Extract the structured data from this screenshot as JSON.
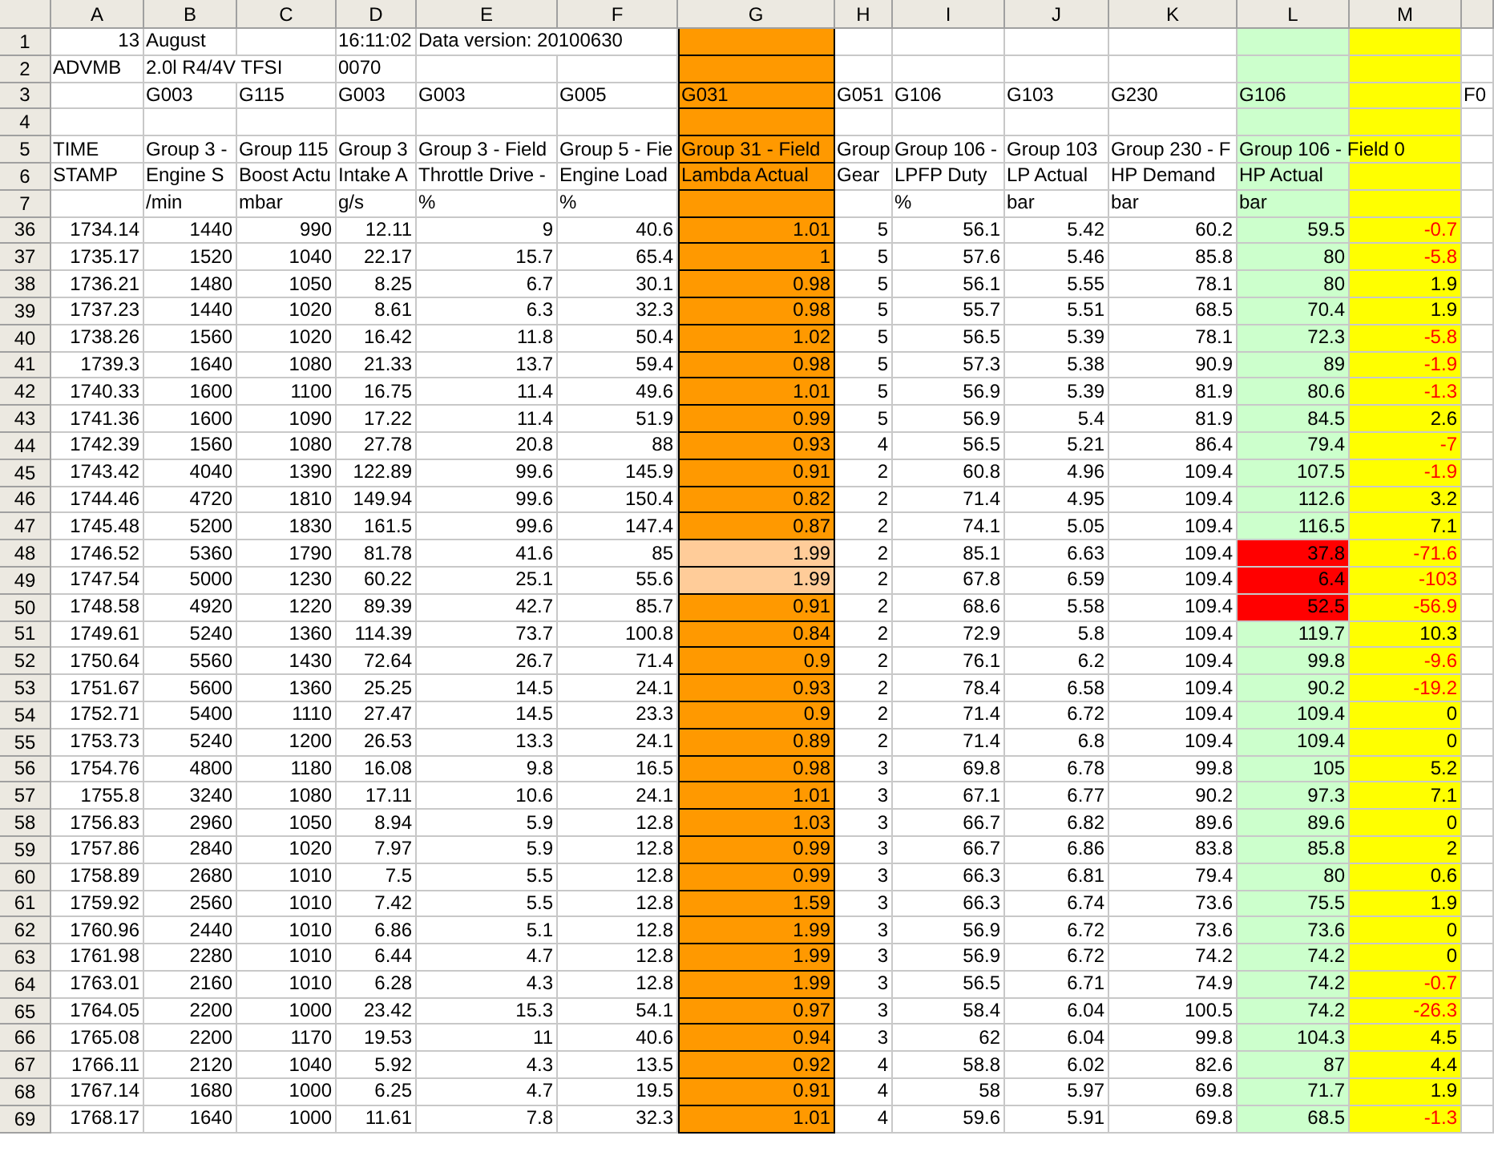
{
  "columns": [
    {
      "label": "A"
    },
    {
      "label": "B"
    },
    {
      "label": "C"
    },
    {
      "label": "D"
    },
    {
      "label": "E"
    },
    {
      "label": "F"
    },
    {
      "label": "G",
      "color": "#ff9900"
    },
    {
      "label": "H"
    },
    {
      "label": "I"
    },
    {
      "label": "J"
    },
    {
      "label": "K"
    },
    {
      "label": "L",
      "color": "#ccffcc"
    },
    {
      "label": "M",
      "color": "#ffff00"
    },
    {}
  ],
  "rows": [
    {
      "label": "1",
      "cells": {
        "A": {
          "text": "13",
          "kind": "number"
        },
        "B": "August",
        "D": "16:11:02",
        "E": "Data version: 20100630"
      }
    },
    {
      "label": "2",
      "cells": {
        "A": "ADVMB",
        "B": "2.0l R4/4V TFSI",
        "D": "0070"
      }
    },
    {
      "label": "3",
      "cells": {
        "B": "G003",
        "C": "G115",
        "D": "G003",
        "E": "G003",
        "F": "G005",
        "G": "G031",
        "H": "G051",
        "I": "G106",
        "J": "G103",
        "K": "G230",
        "L": "G106",
        "N": "F0"
      }
    },
    {
      "label": "4",
      "cells": {}
    },
    {
      "label": "5",
      "cells": {
        "A": "TIME",
        "B": "Group 3 -",
        "C": "Group 115",
        "D": "Group 3",
        "E": "Group 3 - Field",
        "F": "Group 5 - Fie",
        "G": "Group 31 - Field",
        "H": "Group",
        "I": "Group 106 -",
        "J": "Group 103",
        "K": "Group 230 - F",
        "L": "Group 106 - Field 0"
      }
    },
    {
      "label": "6",
      "cells": {
        "A": "STAMP",
        "B": "Engine S",
        "C": "Boost Actu",
        "D": "Intake A",
        "E": "Throttle Drive -",
        "F": "Engine Load",
        "G": "Lambda Actual",
        "H": "Gear",
        "I": "LPFP Duty",
        "J": "LP Actual",
        "K": "HP Demand",
        "L": "HP Actual"
      }
    },
    {
      "label": "7",
      "cells": {
        "B": "/min",
        "C": "mbar",
        "D": "g/s",
        "E": "%",
        "F": "%",
        "I": "%",
        "J": "bar",
        "K": "bar",
        "L": "bar"
      }
    },
    {
      "label": "36",
      "cells": [
        "1734.14",
        "1440",
        "990",
        "12.11",
        "9",
        "40.6",
        "1.01",
        "5",
        "56.1",
        "5.42",
        "60.2",
        "59.5",
        {
          "text": "-0.7",
          "alert": true
        }
      ]
    },
    {
      "label": "37",
      "cells": [
        "1735.17",
        "1520",
        "1040",
        "22.17",
        "15.7",
        "65.4",
        "1",
        "5",
        "57.6",
        "5.46",
        "85.8",
        "80",
        {
          "text": "-5.8",
          "alert": true
        }
      ]
    },
    {
      "label": "38",
      "cells": [
        "1736.21",
        "1480",
        "1050",
        "8.25",
        "6.7",
        "30.1",
        "0.98",
        "5",
        "56.1",
        "5.55",
        "78.1",
        "80",
        "1.9"
      ]
    },
    {
      "label": "39",
      "cells": [
        "1737.23",
        "1440",
        "1020",
        "8.61",
        "6.3",
        "32.3",
        "0.98",
        "5",
        "55.7",
        "5.51",
        "68.5",
        "70.4",
        "1.9"
      ]
    },
    {
      "label": "40",
      "cells": [
        "1738.26",
        "1560",
        "1020",
        "16.42",
        "11.8",
        "50.4",
        "1.02",
        "5",
        "56.5",
        "5.39",
        "78.1",
        "72.3",
        {
          "text": "-5.8",
          "alert": true
        }
      ]
    },
    {
      "label": "41",
      "cells": [
        "1739.3",
        "1640",
        "1080",
        "21.33",
        "13.7",
        "59.4",
        "0.98",
        "5",
        "57.3",
        "5.38",
        "90.9",
        "89",
        {
          "text": "-1.9",
          "alert": true
        }
      ]
    },
    {
      "label": "42",
      "cells": [
        "1740.33",
        "1600",
        "1100",
        "16.75",
        "11.4",
        "49.6",
        "1.01",
        "5",
        "56.9",
        "5.39",
        "81.9",
        "80.6",
        {
          "text": "-1.3",
          "alert": true
        }
      ]
    },
    {
      "label": "43",
      "cells": [
        "1741.36",
        "1600",
        "1090",
        "17.22",
        "11.4",
        "51.9",
        "0.99",
        "5",
        "56.9",
        "5.4",
        "81.9",
        "84.5",
        "2.6"
      ]
    },
    {
      "label": "44",
      "cells": [
        "1742.39",
        "1560",
        "1080",
        "27.78",
        "20.8",
        "88",
        "0.93",
        "4",
        "56.5",
        "5.21",
        "86.4",
        "79.4",
        {
          "text": "-7",
          "alert": true
        }
      ]
    },
    {
      "label": "45",
      "cells": [
        "1743.42",
        "4040",
        "1390",
        "122.89",
        "99.6",
        "145.9",
        "0.91",
        "2",
        "60.8",
        "4.96",
        "109.4",
        "107.5",
        {
          "text": "-1.9",
          "alert": true
        }
      ]
    },
    {
      "label": "46",
      "cells": [
        "1744.46",
        "4720",
        "1810",
        "149.94",
        "99.6",
        "150.4",
        "0.82",
        "2",
        "71.4",
        "4.95",
        "109.4",
        "112.6",
        "3.2"
      ]
    },
    {
      "label": "47",
      "cells": [
        "1745.48",
        "5200",
        "1830",
        "161.5",
        "99.6",
        "147.4",
        "0.87",
        "2",
        "74.1",
        "5.05",
        "109.4",
        "116.5",
        "7.1"
      ]
    },
    {
      "label": "48",
      "cells": [
        "1746.52",
        "5360",
        "1790",
        "81.78",
        "41.6",
        "85",
        {
          "text": "1.99",
          "color": "#ffcc99"
        },
        "2",
        "85.1",
        "6.63",
        "109.4",
        {
          "text": "37.8",
          "color": "#ff0000"
        },
        {
          "text": "-71.6",
          "alert": true
        }
      ]
    },
    {
      "label": "49",
      "cells": [
        "1747.54",
        "5000",
        "1230",
        "60.22",
        "25.1",
        "55.6",
        {
          "text": "1.99",
          "color": "#ffcc99"
        },
        "2",
        "67.8",
        "6.59",
        "109.4",
        {
          "text": "6.4",
          "color": "#ff0000"
        },
        {
          "text": "-103",
          "alert": true
        }
      ]
    },
    {
      "label": "50",
      "cells": [
        "1748.58",
        "4920",
        "1220",
        "89.39",
        "42.7",
        "85.7",
        "0.91",
        "2",
        "68.6",
        "5.58",
        "109.4",
        {
          "text": "52.5",
          "color": "#ff0000"
        },
        {
          "text": "-56.9",
          "alert": true
        }
      ]
    },
    {
      "label": "51",
      "cells": [
        "1749.61",
        "5240",
        "1360",
        "114.39",
        "73.7",
        "100.8",
        "0.84",
        "2",
        "72.9",
        "5.8",
        "109.4",
        "119.7",
        "10.3"
      ]
    },
    {
      "label": "52",
      "cells": [
        "1750.64",
        "5560",
        "1430",
        "72.64",
        "26.7",
        "71.4",
        "0.9",
        "2",
        "76.1",
        "6.2",
        "109.4",
        "99.8",
        {
          "text": "-9.6",
          "alert": true
        }
      ]
    },
    {
      "label": "53",
      "cells": [
        "1751.67",
        "5600",
        "1360",
        "25.25",
        "14.5",
        "24.1",
        "0.93",
        "2",
        "78.4",
        "6.58",
        "109.4",
        "90.2",
        {
          "text": "-19.2",
          "alert": true
        }
      ]
    },
    {
      "label": "54",
      "cells": [
        "1752.71",
        "5400",
        "1110",
        "27.47",
        "14.5",
        "23.3",
        "0.9",
        "2",
        "71.4",
        "6.72",
        "109.4",
        "109.4",
        "0"
      ]
    },
    {
      "label": "55",
      "cells": [
        "1753.73",
        "5240",
        "1200",
        "26.53",
        "13.3",
        "24.1",
        "0.89",
        "2",
        "71.4",
        "6.8",
        "109.4",
        "109.4",
        "0"
      ]
    },
    {
      "label": "56",
      "cells": [
        "1754.76",
        "4800",
        "1180",
        "16.08",
        "9.8",
        "16.5",
        "0.98",
        "3",
        "69.8",
        "6.78",
        "99.8",
        "105",
        "5.2"
      ]
    },
    {
      "label": "57",
      "cells": [
        "1755.8",
        "3240",
        "1080",
        "17.11",
        "10.6",
        "24.1",
        "1.01",
        "3",
        "67.1",
        "6.77",
        "90.2",
        "97.3",
        "7.1"
      ]
    },
    {
      "label": "58",
      "cells": [
        "1756.83",
        "2960",
        "1050",
        "8.94",
        "5.9",
        "12.8",
        "1.03",
        "3",
        "66.7",
        "6.82",
        "89.6",
        "89.6",
        "0"
      ]
    },
    {
      "label": "59",
      "cells": [
        "1757.86",
        "2840",
        "1020",
        "7.97",
        "5.9",
        "12.8",
        "0.99",
        "3",
        "66.7",
        "6.86",
        "83.8",
        "85.8",
        "2"
      ]
    },
    {
      "label": "60",
      "cells": [
        "1758.89",
        "2680",
        "1010",
        "7.5",
        "5.5",
        "12.8",
        "0.99",
        "3",
        "66.3",
        "6.81",
        "79.4",
        "80",
        "0.6"
      ]
    },
    {
      "label": "61",
      "cells": [
        "1759.92",
        "2560",
        "1010",
        "7.42",
        "5.5",
        "12.8",
        "1.59",
        "3",
        "66.3",
        "6.74",
        "73.6",
        "75.5",
        "1.9"
      ]
    },
    {
      "label": "62",
      "cells": [
        "1760.96",
        "2440",
        "1010",
        "6.86",
        "5.1",
        "12.8",
        "1.99",
        "3",
        "56.9",
        "6.72",
        "73.6",
        "73.6",
        "0"
      ]
    },
    {
      "label": "63",
      "cells": [
        "1761.98",
        "2280",
        "1010",
        "6.44",
        "4.7",
        "12.8",
        "1.99",
        "3",
        "56.9",
        "6.72",
        "74.2",
        "74.2",
        "0"
      ]
    },
    {
      "label": "64",
      "cells": [
        "1763.01",
        "2160",
        "1010",
        "6.28",
        "4.3",
        "12.8",
        "1.99",
        "3",
        "56.5",
        "6.71",
        "74.9",
        "74.2",
        {
          "text": "-0.7",
          "alert": true
        }
      ]
    },
    {
      "label": "65",
      "cells": [
        "1764.05",
        "2200",
        "1000",
        "23.42",
        "15.3",
        "54.1",
        "0.97",
        "3",
        "58.4",
        "6.04",
        "100.5",
        "74.2",
        {
          "text": "-26.3",
          "alert": true
        }
      ]
    },
    {
      "label": "66",
      "cells": [
        "1765.08",
        "2200",
        "1170",
        "19.53",
        "11",
        "40.6",
        "0.94",
        "3",
        "62",
        "6.04",
        "99.8",
        "104.3",
        "4.5"
      ]
    },
    {
      "label": "67",
      "cells": [
        "1766.11",
        "2120",
        "1040",
        "5.92",
        "4.3",
        "13.5",
        "0.92",
        "4",
        "58.8",
        "6.02",
        "82.6",
        "87",
        "4.4"
      ]
    },
    {
      "label": "68",
      "cells": [
        "1767.14",
        "1680",
        "1000",
        "6.25",
        "4.7",
        "19.5",
        "0.91",
        "4",
        "58",
        "5.97",
        "69.8",
        "71.7",
        "1.9"
      ]
    },
    {
      "label": "69",
      "cells": [
        "1768.17",
        "1640",
        "1000",
        "11.61",
        "7.8",
        "32.3",
        "1.01",
        "4",
        "59.6",
        "5.91",
        "69.8",
        "68.5",
        {
          "text": "-1.3",
          "alert": true
        }
      ]
    }
  ]
}
